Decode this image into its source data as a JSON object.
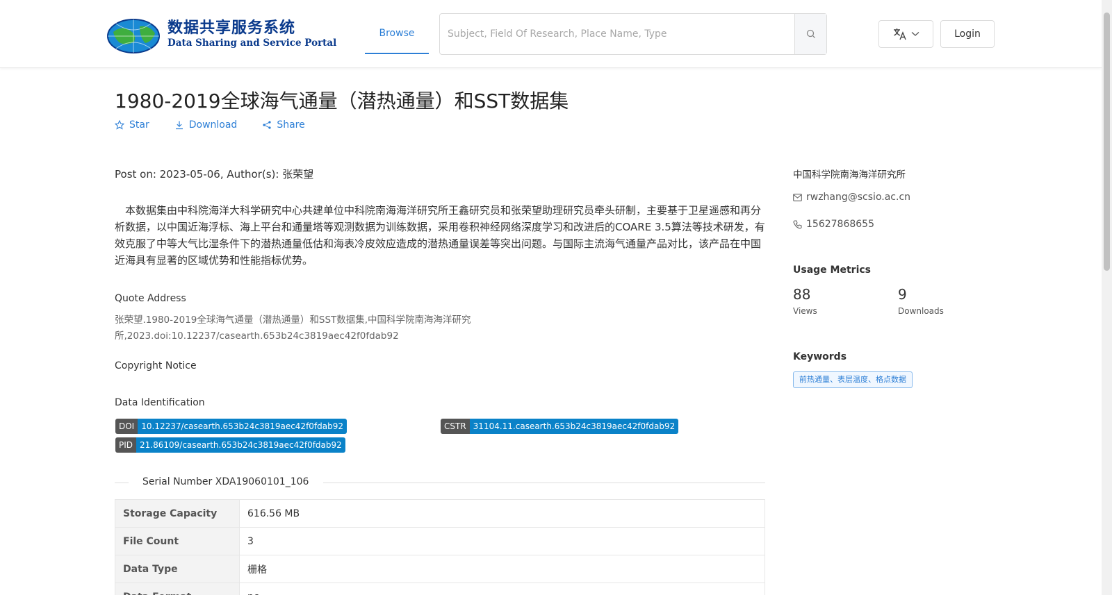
{
  "header": {
    "logo_cn": "数据共享服务系统",
    "logo_en": "Data Sharing and Service Portal",
    "nav_browse": "Browse",
    "search_placeholder": "Subject, Field Of Research, Place Name, Type",
    "login": "Login"
  },
  "dataset": {
    "title": "1980-2019全球海气通量（潜热通量）和SST数据集",
    "actions": {
      "star": "Star",
      "download": "Download",
      "share": "Share"
    },
    "post_line": "Post on: 2023-05-06, Author(s): 张荣望",
    "description": "本数据集由中科院海洋大科学研究中心共建单位中科院南海海洋研究所王鑫研究员和张荣望助理研究员牵头研制，主要基于卫星遥感和再分析数据，以中国近海浮标、海上平台和通量塔等观测数据为训练数据，采用卷积神经网络深度学习和改进后的COARE 3.5算法等技术研发，有效克服了中等大气比湿条件下的潜热通量低估和海表冷皮效应造成的潜热通量误差等突出问题。与国际主流海气通量产品对比，该产品在中国近海具有显著的区域优势和性能指标优势。",
    "quote_heading": "Quote Address",
    "quote_text": "张荣望.1980-2019全球海气通量（潜热通量）和SST数据集,中国科学院南海海洋研究所,2023.doi:10.12237/casearth.653b24c3819aec42f0fdab92",
    "copyright_heading": "Copyright Notice",
    "identification_heading": "Data Identification",
    "identifiers": {
      "doi": {
        "key": "DOI",
        "value": "10.12237/casearth.653b24c3819aec42f0fdab92"
      },
      "cstr": {
        "key": "CSTR",
        "value": "31104.11.casearth.653b24c3819aec42f0fdab92"
      },
      "pid": {
        "key": "PID",
        "value": "21.86109/casearth.653b24c3819aec42f0fdab92"
      }
    },
    "serial": "Serial Number XDA19060101_106",
    "info_rows": [
      {
        "key": "Storage Capacity",
        "value": "616.56 MB"
      },
      {
        "key": "File Count",
        "value": "3"
      },
      {
        "key": "Data Type",
        "value": "栅格"
      },
      {
        "key": "Data Format",
        "value": "nc"
      }
    ]
  },
  "sidebar": {
    "institution": "中国科学院南海海洋研究所",
    "email": "rwzhang@scsio.ac.cn",
    "phone": "15627868655",
    "metrics_heading": "Usage Metrics",
    "views": "88",
    "views_label": "Views",
    "downloads": "9",
    "downloads_label": "Downloads",
    "keywords_heading": "Keywords",
    "keyword": "前热通量、表层温度、格点数据"
  },
  "colors": {
    "accent": "#2d7fd6",
    "badge_value": "#0a82c8",
    "badge_key": "#555555"
  }
}
